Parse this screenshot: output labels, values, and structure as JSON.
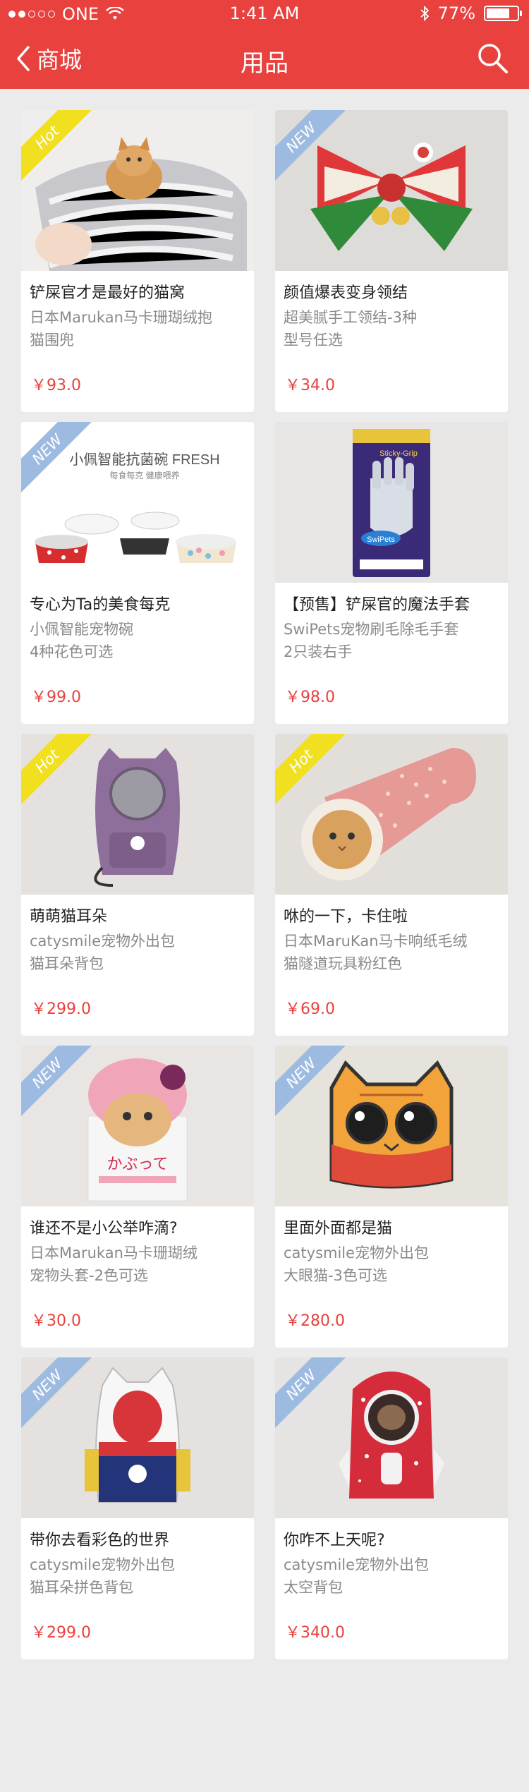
{
  "status": {
    "carrier": "ONE",
    "time": "1:41 AM",
    "battery": "77%",
    "battery_level": 0.77
  },
  "nav": {
    "back_label": "商城",
    "title": "用品",
    "icons": [
      "chevron-left-icon",
      "search-icon"
    ]
  },
  "colors": {
    "brand": "#e8413e",
    "new_badge": "#9dbbe0",
    "hot_badge": "#f0e020",
    "background": "#ebebeb"
  },
  "products": [
    {
      "badge": "Hot",
      "name": "铲屎官才是最好的猫窝",
      "desc": "日本Marukan马卡珊瑚绒抱\n猫围兜",
      "price": "￥93.0"
    },
    {
      "badge": "NEW",
      "name": "颜值爆表变身领结",
      "desc": "超美腻手工领结-3种\n型号任选",
      "price": "￥34.0"
    },
    {
      "badge": "NEW",
      "name": "专心为Ta的美食每克",
      "desc": "小佩智能宠物碗\n4种花色可选",
      "price": "￥99.0",
      "img_text": "小佩智能抗菌碗 FRESH",
      "img_subtext": "每食每克  健康喂养"
    },
    {
      "badge": "",
      "name": "【预售】铲屎官的魔法手套",
      "desc": "SwiPets宠物刷毛除毛手套\n2只装右手",
      "price": "￥98.0",
      "img_text": "SwiPets",
      "img_subtext": "Sticky-Grip"
    },
    {
      "badge": "Hot",
      "name": "萌萌猫耳朵",
      "desc": "catysmile宠物外出包\n猫耳朵背包",
      "price": "￥299.0"
    },
    {
      "badge": "Hot",
      "name": "咻的一下，卡住啦",
      "desc": "日本MaruKan马卡响纸毛绒\n猫隧道玩具粉红色",
      "price": "￥69.0"
    },
    {
      "badge": "NEW",
      "name": "谁还不是小公举咋滴?",
      "desc": "日本Marukan马卡珊瑚绒\n宠物头套-2色可选",
      "price": "￥30.0",
      "img_text": "かぶって"
    },
    {
      "badge": "NEW",
      "name": "里面外面都是猫",
      "desc": "catysmile宠物外出包\n大眼猫-3色可选",
      "price": "￥280.0"
    },
    {
      "badge": "NEW",
      "name": "带你去看彩色的世界",
      "desc": "catysmile宠物外出包\n猫耳朵拼色背包",
      "price": "￥299.0"
    },
    {
      "badge": "NEW",
      "name": "你咋不上天呢?",
      "desc": "catysmile宠物外出包\n太空背包",
      "price": "￥340.0"
    }
  ]
}
